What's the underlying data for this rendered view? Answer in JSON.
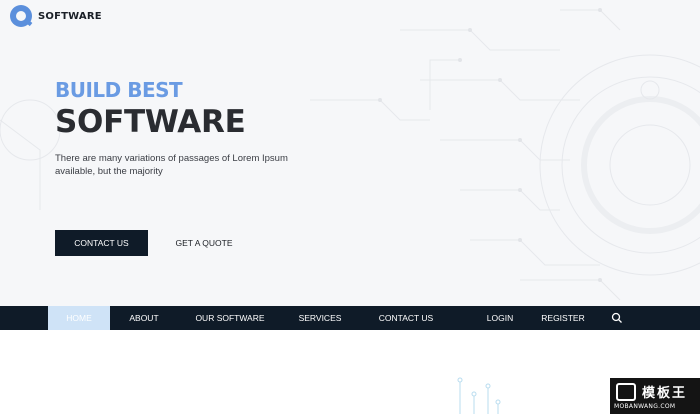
{
  "logo": {
    "text": "SOFTWARE"
  },
  "hero": {
    "headline_small": "BUILD BEST",
    "headline_big": "SOFTWARE",
    "tagline": "There are many variations of passages of Lorem Ipsum available, but the majority",
    "primary_button": "CONTACT US",
    "secondary_button": "GET A QUOTE"
  },
  "nav": {
    "items": [
      {
        "label": "HOME",
        "active": true
      },
      {
        "label": "ABOUT",
        "active": false
      },
      {
        "label": "OUR SOFTWARE",
        "active": false
      },
      {
        "label": "SERVICES",
        "active": false
      },
      {
        "label": "CONTACT US",
        "active": false
      },
      {
        "label": "LOGIN",
        "active": false
      },
      {
        "label": "REGISTER",
        "active": false
      }
    ],
    "search_icon": "search-icon"
  },
  "watermark": {
    "cn_text": "模板王",
    "url": "MOBANWANG.COM"
  },
  "colors": {
    "accent": "#6a9be3",
    "dark": "#0f1b28",
    "active_tab": "#cfe3f7",
    "hero_bg": "#f6f7f9"
  }
}
